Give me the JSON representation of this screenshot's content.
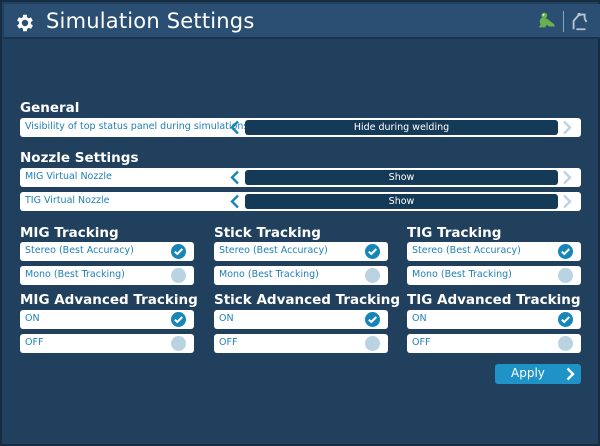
{
  "header": {
    "title": "Simulation Settings",
    "icons": [
      "gear-icon",
      "frog-icon",
      "welding-robot-icon"
    ],
    "accent_color": "#6ab04c"
  },
  "general": {
    "title": "General",
    "rows": [
      {
        "label": "Visibility of top status panel during simulations",
        "value": "Hide during welding"
      }
    ]
  },
  "nozzle": {
    "title": "Nozzle Settings",
    "rows": [
      {
        "label": "MIG Virtual Nozzle",
        "value": "Show"
      },
      {
        "label": "TIG Virtual Nozzle",
        "value": "Show"
      }
    ]
  },
  "tracking": [
    {
      "title": "MIG Tracking",
      "options": [
        {
          "label": "Stereo (Best Accuracy)",
          "selected": true
        },
        {
          "label": "Mono (Best Tracking)",
          "selected": false
        }
      ]
    },
    {
      "title": "Stick Tracking",
      "options": [
        {
          "label": "Stereo (Best Accuracy)",
          "selected": true
        },
        {
          "label": "Mono (Best Tracking)",
          "selected": false
        }
      ]
    },
    {
      "title": "TIG Tracking",
      "options": [
        {
          "label": "Stereo (Best Accuracy)",
          "selected": true
        },
        {
          "label": "Mono (Best Tracking)",
          "selected": false
        }
      ]
    }
  ],
  "advanced": [
    {
      "title": "MIG Advanced Tracking",
      "options": [
        {
          "label": "ON",
          "selected": true
        },
        {
          "label": "OFF",
          "selected": false
        }
      ]
    },
    {
      "title": "Stick Advanced Tracking",
      "options": [
        {
          "label": "ON",
          "selected": true
        },
        {
          "label": "OFF",
          "selected": false
        }
      ]
    },
    {
      "title": "TIG Advanced Tracking",
      "options": [
        {
          "label": "ON",
          "selected": true
        },
        {
          "label": "OFF",
          "selected": false
        }
      ]
    }
  ],
  "apply_label": "Apply",
  "colors": {
    "background": "#21405e",
    "header": "#2b4f73",
    "value_bar": "#153a57",
    "selected": "#1685b8",
    "unselected": "#b9d3e3",
    "label_text": "#1f7fb5",
    "apply_button": "#1f92c8"
  }
}
